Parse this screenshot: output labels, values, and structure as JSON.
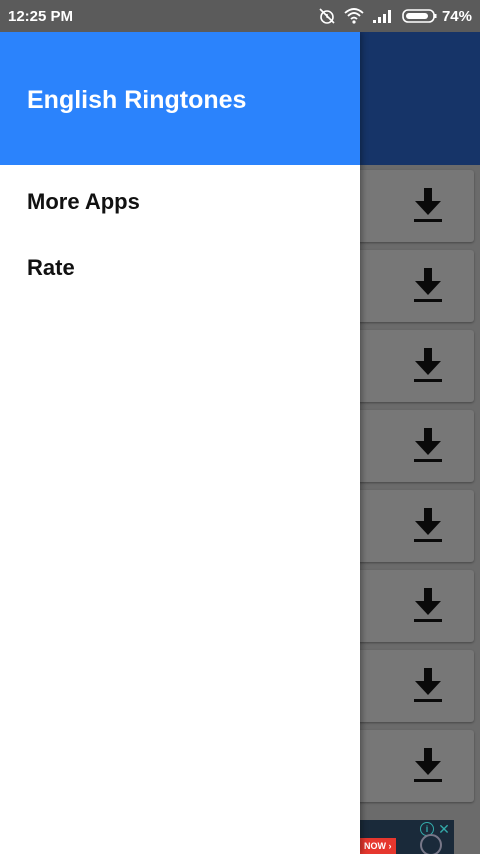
{
  "status_bar": {
    "time": "12:25 PM",
    "battery_percent": "74%",
    "icons": [
      "alarm-off-icon",
      "wifi-icon",
      "signal-icon",
      "battery-icon"
    ]
  },
  "drawer": {
    "title": "English Ringtones",
    "header_color": "#2b83fc",
    "menu_items": [
      {
        "label": "More Apps"
      },
      {
        "label": "Rate"
      }
    ]
  },
  "background_list": {
    "toolbar_color": "#163468",
    "item_icon": "download-icon",
    "item_count": 8
  },
  "ad_banner": {
    "cta": "NOW ›"
  }
}
